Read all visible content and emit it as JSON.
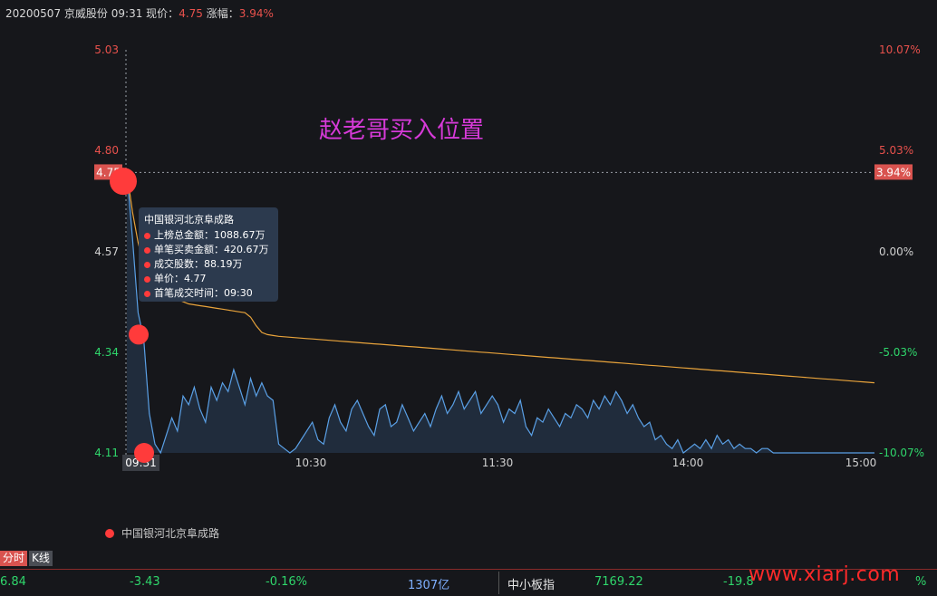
{
  "header": {
    "date": "20200507",
    "stock": "京威股份",
    "time": "09:31",
    "price_label": "现价：",
    "price": "4.75",
    "change_label": "涨幅：",
    "change": "3.94%"
  },
  "colors": {
    "background": "#16171b",
    "price_line": "#5aa0e6",
    "avg_line": "#e8a33b",
    "up": "#e8514c",
    "down": "#2fd66b",
    "marker": "#ff3b3b",
    "tooltip_bg": "#2c3a4e"
  },
  "annotation": "赵老哥买入位置",
  "tooltip": {
    "title": "中国银河北京阜成路",
    "rows": [
      "上榜总金额：1088.67万",
      "单笔买卖金额：420.67万",
      "成交股数：88.19万",
      "单价：4.77",
      "首笔成交时间：09:30"
    ]
  },
  "legend": {
    "label": "中国银河北京阜成路"
  },
  "tabs": {
    "intraday": "分时",
    "kline": "K线"
  },
  "ticker": {
    "v1": "6.84",
    "v2": "-3.43",
    "v3": "-0.16%",
    "v4": "1307亿",
    "index_name": "中小板指",
    "index_value": "7169.22",
    "v5": "-19.8",
    "v6": "%"
  },
  "watermark": "www.xiarj.com",
  "chart_data": {
    "type": "line",
    "ylim": [
      4.11,
      5.03
    ],
    "y_ticks_left": [
      "5.03",
      "4.80",
      "4.57",
      "4.34",
      "4.11"
    ],
    "y_ticks_right": [
      "10.07%",
      "5.03%",
      "0.00%",
      "-5.03%",
      "-10.07%"
    ],
    "x_ticks": [
      "10:30",
      "11:30",
      "14:00",
      "15:00"
    ],
    "crosshair": {
      "x": "09:31",
      "y": "4.75",
      "pct": "3.94%"
    },
    "series": [
      {
        "role": "price",
        "values": [
          4.75,
          4.6,
          4.43,
          4.37,
          4.2,
          4.13,
          4.11,
          4.15,
          4.19,
          4.16,
          4.24,
          4.22,
          4.26,
          4.21,
          4.18,
          4.26,
          4.23,
          4.27,
          4.25,
          4.3,
          4.26,
          4.22,
          4.28,
          4.24,
          4.27,
          4.24,
          4.23,
          4.13,
          4.12,
          4.11,
          4.12,
          4.14,
          4.16,
          4.18,
          4.14,
          4.13,
          4.19,
          4.22,
          4.18,
          4.16,
          4.21,
          4.23,
          4.2,
          4.17,
          4.15,
          4.21,
          4.22,
          4.17,
          4.18,
          4.22,
          4.19,
          4.16,
          4.18,
          4.2,
          4.17,
          4.21,
          4.24,
          4.2,
          4.22,
          4.25,
          4.21,
          4.23,
          4.25,
          4.2,
          4.22,
          4.24,
          4.22,
          4.18,
          4.21,
          4.2,
          4.23,
          4.17,
          4.15,
          4.19,
          4.18,
          4.21,
          4.19,
          4.17,
          4.2,
          4.19,
          4.22,
          4.21,
          4.19,
          4.23,
          4.21,
          4.24,
          4.22,
          4.25,
          4.23,
          4.2,
          4.22,
          4.19,
          4.17,
          4.18,
          4.14,
          4.15,
          4.13,
          4.12,
          4.14,
          4.11,
          4.12,
          4.13,
          4.12,
          4.14,
          4.12,
          4.15,
          4.13,
          4.14,
          4.12,
          4.13,
          4.12,
          4.12,
          4.11,
          4.12,
          4.12,
          4.11,
          4.11,
          4.11,
          4.11,
          4.11,
          4.11,
          4.11,
          4.11,
          4.11,
          4.11,
          4.11,
          4.11,
          4.11,
          4.11,
          4.11,
          4.11,
          4.11,
          4.11,
          4.11
        ]
      },
      {
        "role": "average",
        "values": [
          4.75,
          4.66,
          4.59,
          4.54,
          4.51,
          4.49,
          4.48,
          4.47,
          4.465,
          4.46,
          4.455,
          4.45,
          4.448,
          4.446,
          4.444,
          4.442,
          4.44,
          4.438,
          4.436,
          4.434,
          4.432,
          4.43,
          4.42,
          4.4,
          4.385,
          4.38,
          4.378,
          4.376,
          4.375,
          4.374,
          4.373,
          4.372,
          4.371,
          4.37,
          4.369,
          4.368,
          4.367,
          4.366,
          4.365,
          4.364,
          4.363,
          4.362,
          4.361,
          4.36,
          4.359,
          4.358,
          4.357,
          4.356,
          4.355,
          4.354,
          4.353,
          4.352,
          4.351,
          4.35,
          4.349,
          4.348,
          4.347,
          4.346,
          4.345,
          4.344,
          4.343,
          4.342,
          4.341,
          4.34,
          4.339,
          4.338,
          4.337,
          4.336,
          4.335,
          4.334,
          4.333,
          4.332,
          4.331,
          4.33,
          4.329,
          4.328,
          4.327,
          4.326,
          4.325,
          4.324,
          4.323,
          4.322,
          4.321,
          4.32,
          4.319,
          4.318,
          4.317,
          4.316,
          4.315,
          4.314,
          4.313,
          4.312,
          4.311,
          4.31,
          4.309,
          4.308,
          4.307,
          4.306,
          4.305,
          4.304,
          4.303,
          4.302,
          4.301,
          4.3,
          4.299,
          4.298,
          4.297,
          4.296,
          4.295,
          4.294,
          4.293,
          4.292,
          4.291,
          4.29,
          4.289,
          4.288,
          4.287,
          4.286,
          4.285,
          4.284,
          4.283,
          4.282,
          4.281,
          4.28,
          4.279,
          4.278,
          4.277,
          4.276,
          4.275,
          4.274,
          4.273,
          4.272,
          4.271,
          4.27
        ]
      }
    ],
    "markers": [
      {
        "index": 0,
        "value": 4.73
      },
      {
        "index": 1,
        "value": 4.38
      },
      {
        "index": 2,
        "value": 4.11
      }
    ]
  }
}
